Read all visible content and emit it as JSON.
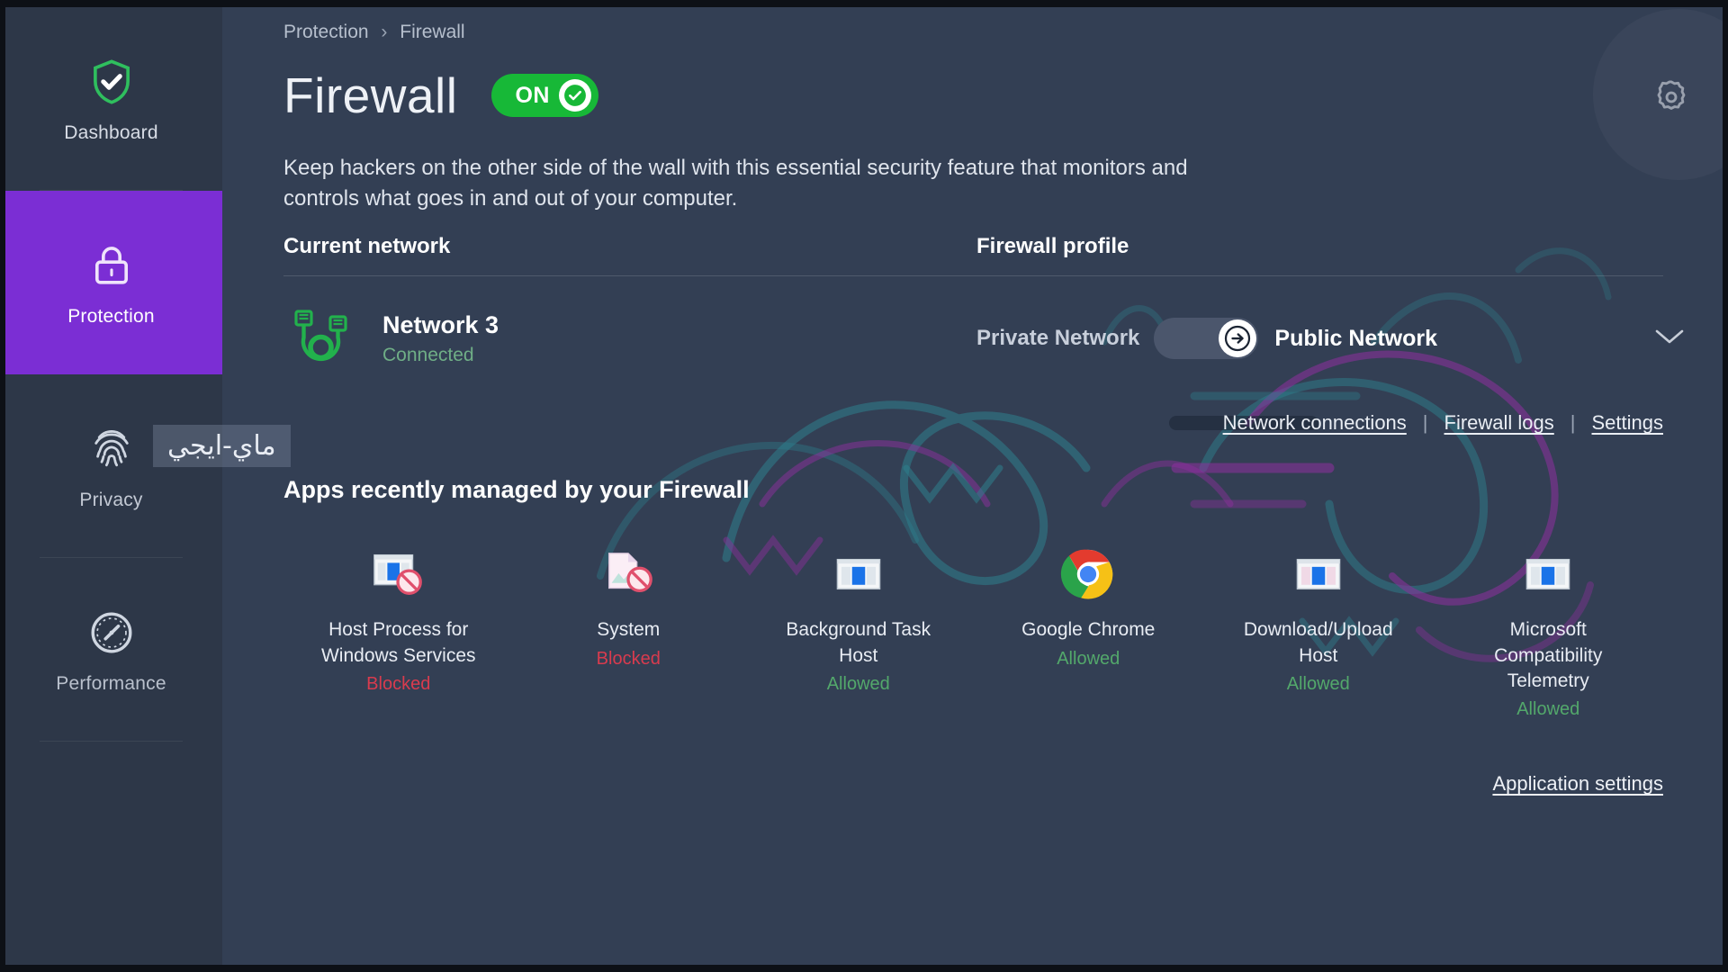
{
  "app": {
    "accent_purple": "#7b2ed4",
    "accent_green": "#17b837",
    "bg_main": "#333f54",
    "bg_sidebar": "#2d3748"
  },
  "sidebar": {
    "items": [
      {
        "label": "Dashboard",
        "icon": "shield-check-icon",
        "active": false
      },
      {
        "label": "Protection",
        "icon": "lock-icon",
        "active": true
      },
      {
        "label": "Privacy",
        "icon": "fingerprint-icon",
        "active": false
      },
      {
        "label": "Performance",
        "icon": "speedometer-icon",
        "active": false
      }
    ]
  },
  "header": {
    "breadcrumb": {
      "parent": "Protection",
      "separator": "›",
      "current": "Firewall"
    },
    "title": "Firewall",
    "toggle": {
      "label": "ON",
      "state": "on",
      "icon": "check-circle-icon"
    },
    "settings_icon": "gear-icon"
  },
  "description": "Keep hackers on the other side of the wall with this essential security feature that monitors and controls what goes in and out of your computer.",
  "columns": {
    "current_network": "Current network",
    "firewall_profile": "Firewall profile"
  },
  "network": {
    "icon": "network-cable-icon",
    "name": "Network 3",
    "status": "Connected"
  },
  "profile": {
    "left_label": "Private Network",
    "right_label": "Public Network",
    "selected": "Public Network",
    "switch_icon": "arrow-right-circle-icon",
    "expand_icon": "chevron-down-icon"
  },
  "links": {
    "network_connections": "Network connections",
    "separator": "|",
    "firewall_logs": "Firewall logs",
    "settings": "Settings"
  },
  "apps_section": {
    "heading": "Apps recently managed by your Firewall",
    "apps": [
      {
        "name": "Host Process for Windows Services",
        "status": "Blocked",
        "state": "blocked",
        "icon": "windows-app-blocked-icon"
      },
      {
        "name": "System",
        "status": "Blocked",
        "state": "blocked",
        "icon": "system-file-blocked-icon"
      },
      {
        "name": "Background Task Host",
        "status": "Allowed",
        "state": "allowed",
        "icon": "windows-app-icon"
      },
      {
        "name": "Google Chrome",
        "status": "Allowed",
        "state": "allowed",
        "icon": "chrome-icon"
      },
      {
        "name": "Download/Upload Host",
        "status": "Allowed",
        "state": "allowed",
        "icon": "windows-app-icon"
      },
      {
        "name": "Microsoft Compatibility Telemetry",
        "status": "Allowed",
        "state": "allowed",
        "icon": "windows-app-icon"
      }
    ],
    "application_settings": "Application settings"
  },
  "watermark": {
    "text": "ماي-ايجي"
  }
}
